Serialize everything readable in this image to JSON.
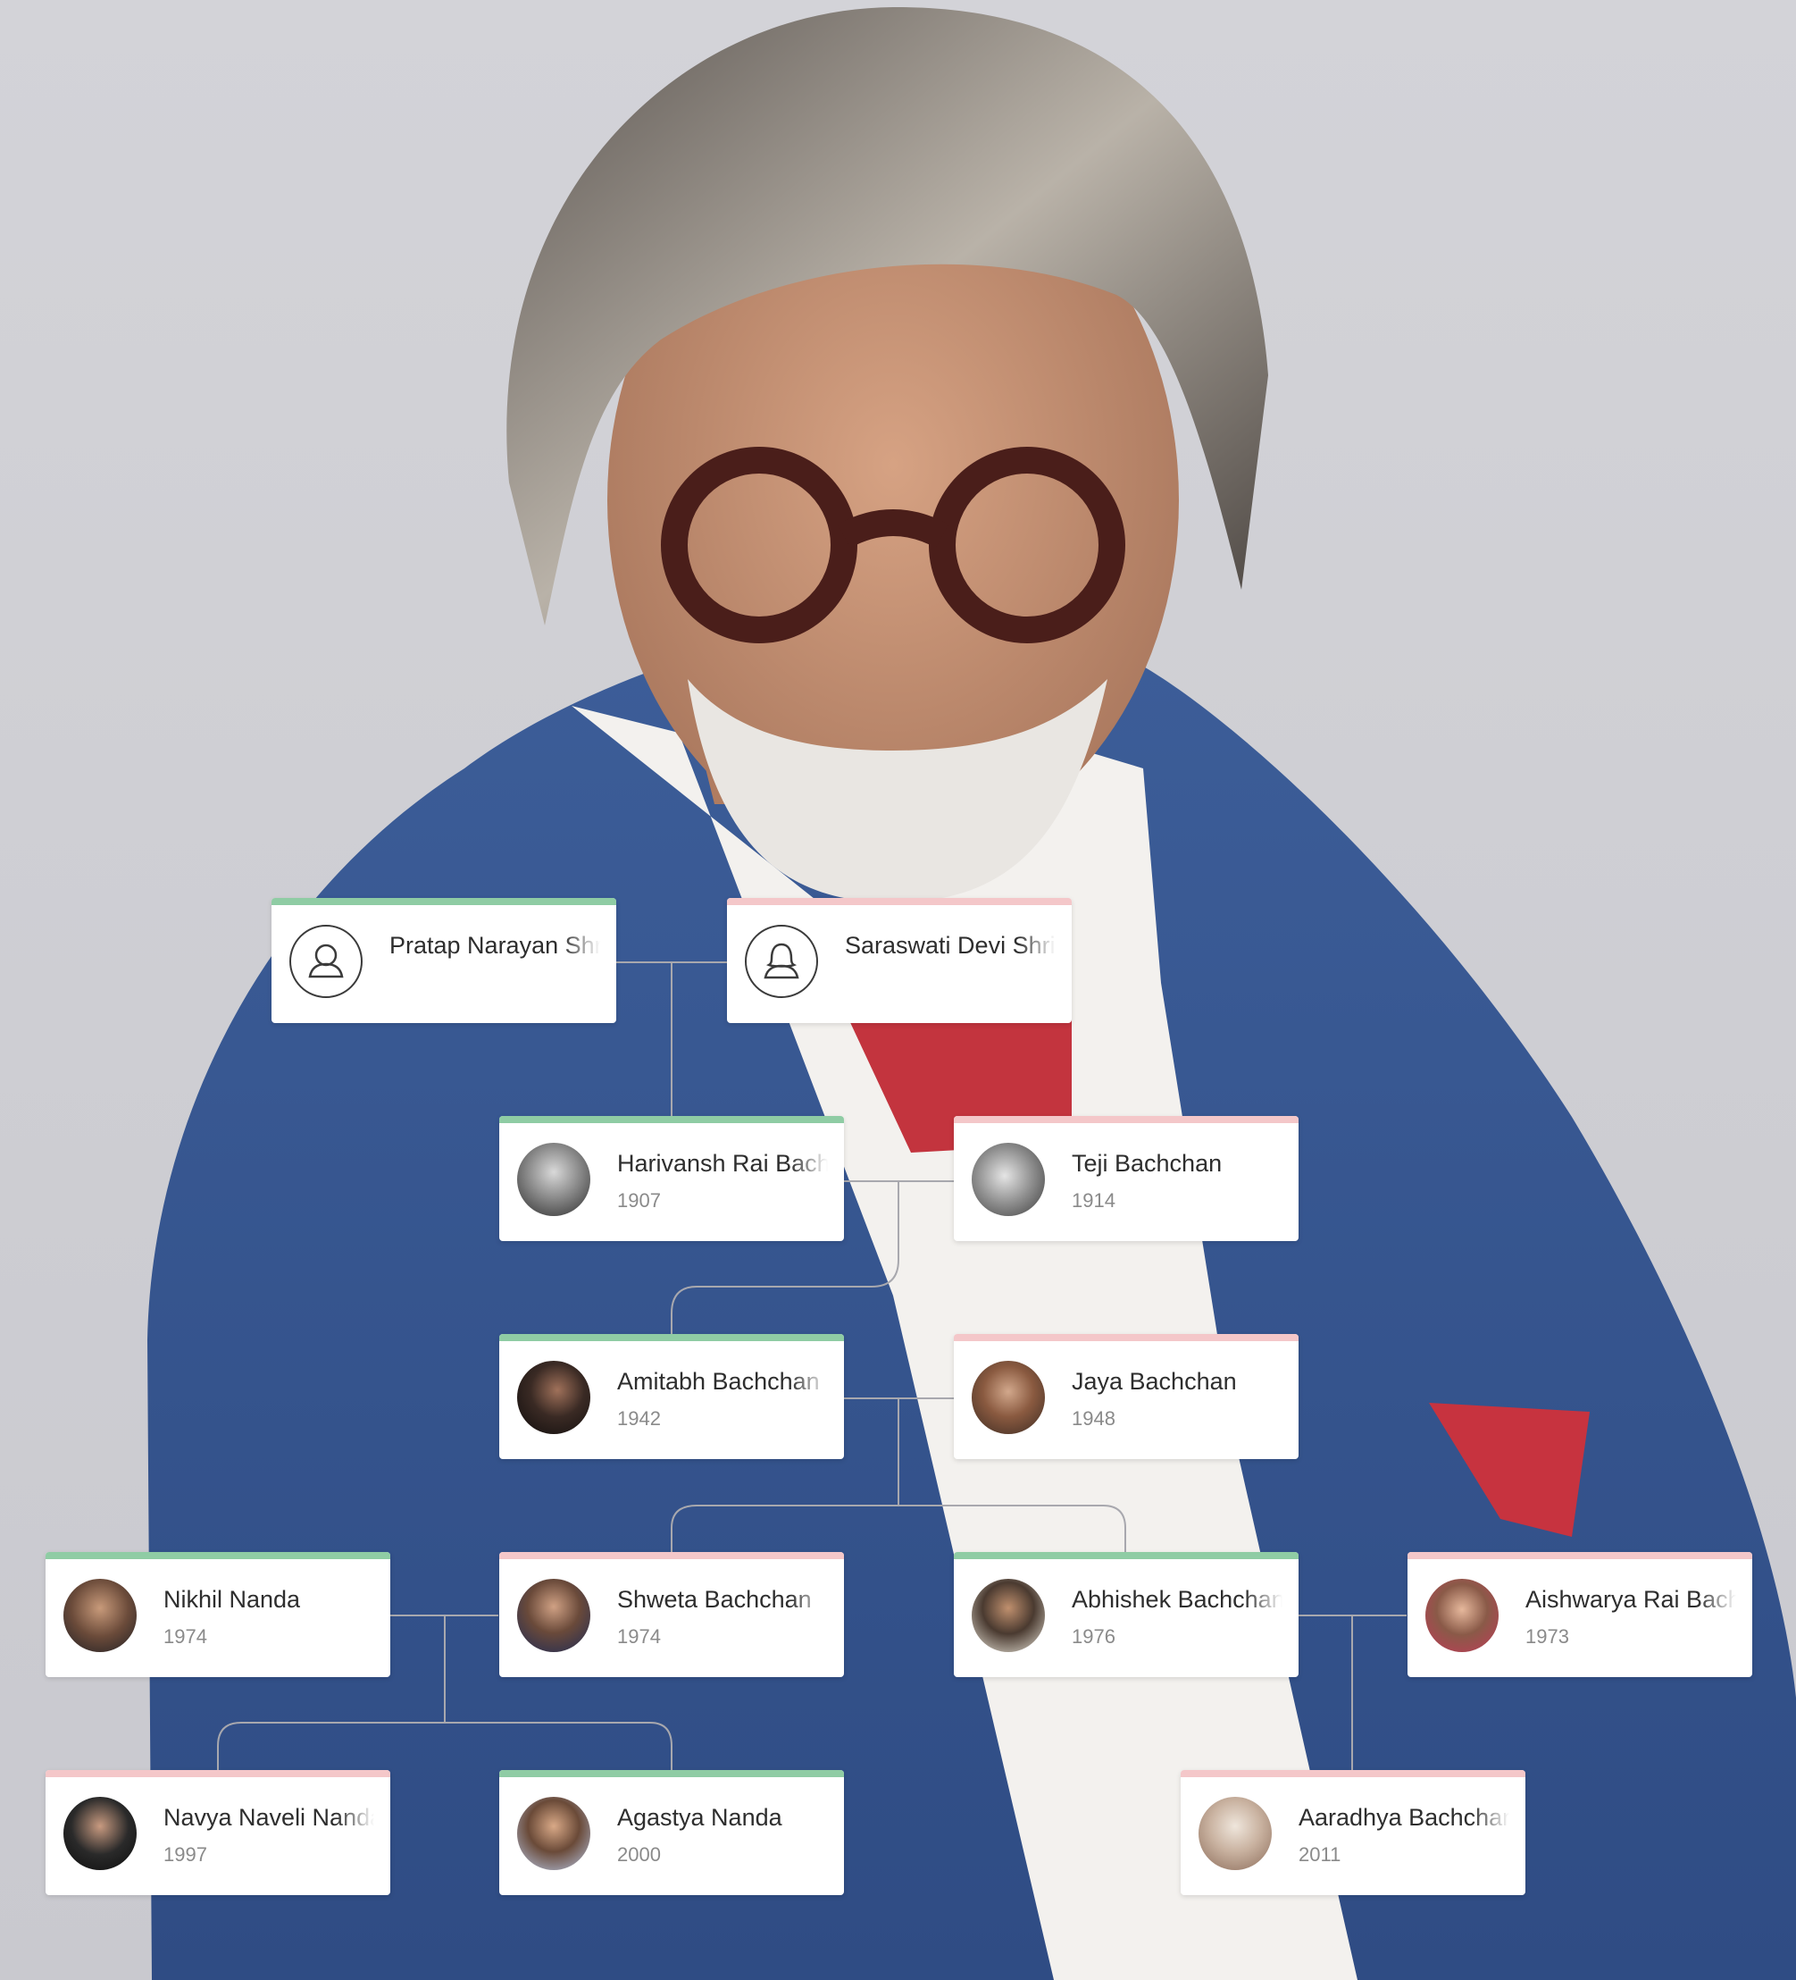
{
  "colors": {
    "male_bar": "#8fcca4",
    "female_bar": "#f4c7c9",
    "connector": "#a8a8ae"
  },
  "tree": {
    "people": [
      {
        "id": "pratap",
        "name": "Pratap Narayan Shrivastava",
        "year": "",
        "gender": "male",
        "avatar": "user-outline-icon"
      },
      {
        "id": "saraswati",
        "name": "Saraswati Devi Shrivastava",
        "year": "",
        "gender": "female",
        "avatar": "user-outline-icon"
      },
      {
        "id": "harivansh",
        "name": "Harivansh Rai Bachchan",
        "year": "1907",
        "gender": "male",
        "avatar": "portrait-photo"
      },
      {
        "id": "teji",
        "name": "Teji Bachchan",
        "year": "1914",
        "gender": "female",
        "avatar": "portrait-photo"
      },
      {
        "id": "amitabh",
        "name": "Amitabh Bachchan",
        "year": "1942",
        "gender": "male",
        "avatar": "portrait-photo"
      },
      {
        "id": "jaya",
        "name": "Jaya Bachchan",
        "year": "1948",
        "gender": "female",
        "avatar": "portrait-photo"
      },
      {
        "id": "nikhil",
        "name": "Nikhil Nanda",
        "year": "1974",
        "gender": "male",
        "avatar": "portrait-photo"
      },
      {
        "id": "shweta",
        "name": "Shweta Bachchan",
        "year": "1974",
        "gender": "female",
        "avatar": "portrait-photo"
      },
      {
        "id": "abhishek",
        "name": "Abhishek Bachchan",
        "year": "1976",
        "gender": "male",
        "avatar": "portrait-photo"
      },
      {
        "id": "aishwarya",
        "name": "Aishwarya Rai Bachchan",
        "year": "1973",
        "gender": "female",
        "avatar": "portrait-photo"
      },
      {
        "id": "navya",
        "name": "Navya Naveli Nanda",
        "year": "1997",
        "gender": "female",
        "avatar": "portrait-photo"
      },
      {
        "id": "agastya",
        "name": "Agastya Nanda",
        "year": "2000",
        "gender": "male",
        "avatar": "portrait-photo"
      },
      {
        "id": "aaradhya",
        "name": "Aaradhya Bachchan",
        "year": "2011",
        "gender": "female",
        "avatar": "portrait-photo"
      }
    ]
  }
}
